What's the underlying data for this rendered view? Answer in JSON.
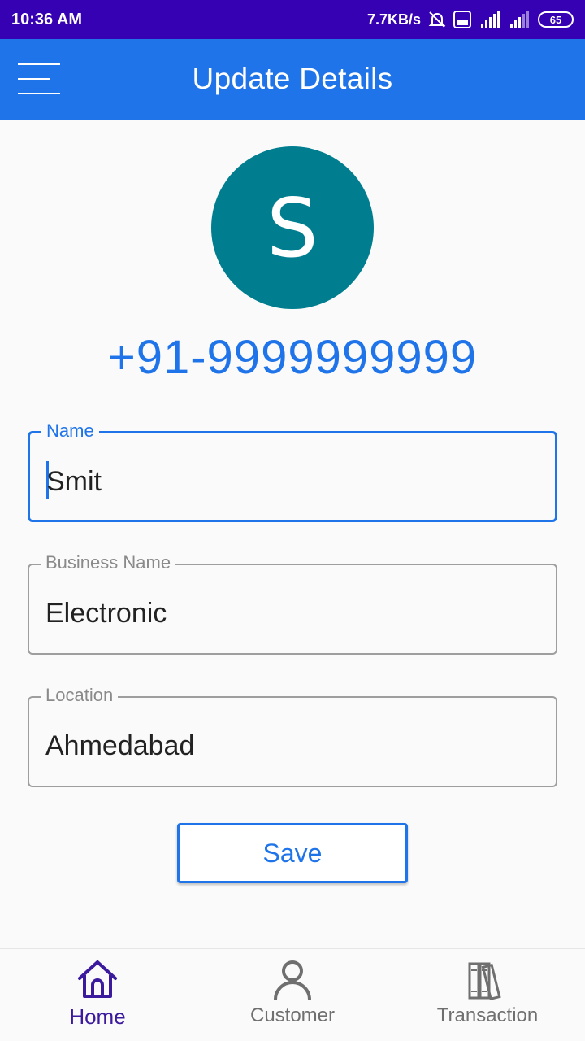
{
  "status_bar": {
    "time": "10:36 AM",
    "speed": "7.7KB/s",
    "network": "4G",
    "battery": "65"
  },
  "app_bar": {
    "title": "Update Details"
  },
  "profile": {
    "avatar_initial": "S",
    "avatar_color": "#007e8f",
    "phone": "+91-9999999999"
  },
  "form": {
    "name": {
      "label": "Name",
      "value": "Smit"
    },
    "business": {
      "label": "Business Name",
      "value": "Electronic"
    },
    "location": {
      "label": "Location",
      "value": "Ahmedabad"
    },
    "save_label": "Save"
  },
  "bottom_nav": {
    "items": [
      {
        "label": "Home",
        "icon": "home-icon",
        "active": true
      },
      {
        "label": "Customer",
        "icon": "person-icon",
        "active": false
      },
      {
        "label": "Transaction",
        "icon": "books-icon",
        "active": false
      }
    ]
  },
  "colors": {
    "status_bar": "#3600b3",
    "primary": "#1e74e8",
    "nav_active": "#3b1a9e"
  }
}
